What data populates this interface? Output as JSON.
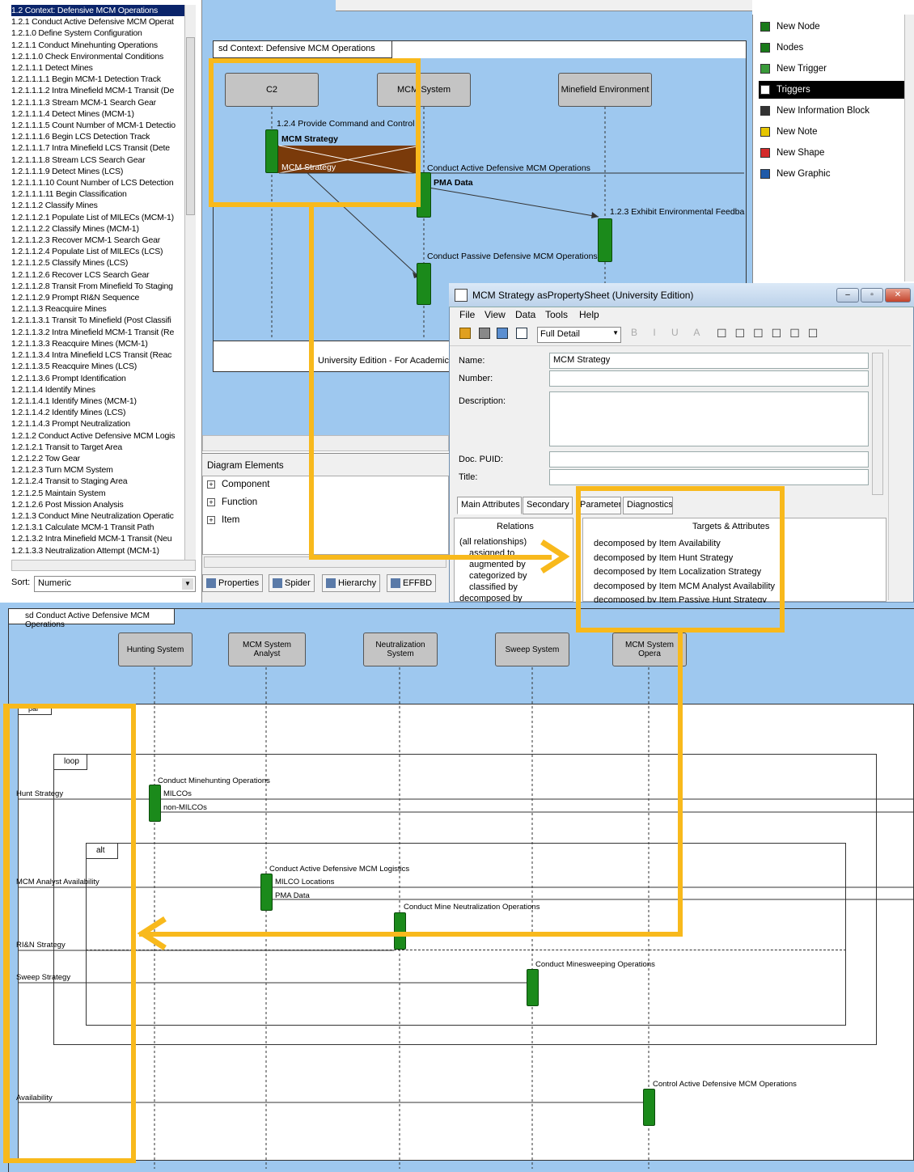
{
  "outline": {
    "items": [
      "1.2 Context: Defensive MCM Operations",
      "1.2.1 Conduct Active Defensive MCM Operat",
      "1.2.1.0 Define System Configuration",
      "1.2.1.1 Conduct Minehunting Operations",
      "1.2.1.1.0 Check Environmental Conditions",
      "1.2.1.1.1 Detect Mines",
      "1.2.1.1.1.1 Begin MCM-1 Detection Track",
      "1.2.1.1.1.2 Intra Minefield MCM-1 Transit (De",
      "1.2.1.1.1.3 Stream MCM-1 Search Gear",
      "1.2.1.1.1.4 Detect Mines (MCM-1)",
      "1.2.1.1.1.5 Count Number of MCM-1 Detectio",
      "1.2.1.1.1.6 Begin LCS Detection Track",
      "1.2.1.1.1.7 Intra Minefield LCS Transit (Dete",
      "1.2.1.1.1.8 Stream LCS Search Gear",
      "1.2.1.1.1.9 Detect Mines (LCS)",
      "1.2.1.1.1.10 Count Number of LCS Detection",
      "1.2.1.1.1.11 Begin Classification",
      "1.2.1.1.2 Classify Mines",
      "1.2.1.1.2.1 Populate List of MILECs (MCM-1)",
      "1.2.1.1.2.2 Classify Mines (MCM-1)",
      "1.2.1.1.2.3 Recover MCM-1 Search Gear",
      "1.2.1.1.2.4 Populate List of MILECs (LCS)",
      "1.2.1.1.2.5 Classify Mines (LCS)",
      "1.2.1.1.2.6 Recover LCS Search Gear",
      "1.2.1.1.2.8 Transit From Minefield To Staging",
      "1.2.1.1.2.9 Prompt RI&N Sequence",
      "1.2.1.1.3 Reacquire Mines",
      "1.2.1.1.3.1 Transit To Minefield (Post Classifi",
      "1.2.1.1.3.2 Intra Minefield MCM-1 Transit (Re",
      "1.2.1.1.3.3 Reacquire Mines (MCM-1)",
      "1.2.1.1.3.4 Intra Minefield LCS Transit (Reac",
      "1.2.1.1.3.5 Reacquire Mines (LCS)",
      "1.2.1.1.3.6 Prompt Identification",
      "1.2.1.1.4 Identify Mines",
      "1.2.1.1.4.1 Identify Mines (MCM-1)",
      "1.2.1.1.4.2 Identify Mines (LCS)",
      "1.2.1.1.4.3 Prompt Neutralization",
      "1.2.1.2 Conduct Active Defensive MCM Logis",
      "1.2.1.2.1 Transit to Target Area",
      "1.2.1.2.2 Tow Gear",
      "1.2.1.2.3 Turn MCM System",
      "1.2.1.2.4 Transit to Staging Area",
      "1.2.1.2.5 Maintain System",
      "1.2.1.2.6 Post Mission Analysis",
      "1.2.1.3 Conduct Mine Neutralization Operatic",
      "1.2.1.3.1 Calculate MCM-1 Transit Path",
      "1.2.1.3.2 Intra Minefield MCM-1 Transit (Neu",
      "1.2.1.3.3 Neutralization Attempt (MCM-1)"
    ],
    "sort_label": "Sort:",
    "sort_value": "Numeric"
  },
  "top_diagram": {
    "frame_title": "sd Context: Defensive MCM Operations",
    "lifelines": [
      "C2",
      "MCM System",
      "Minefield Environment"
    ],
    "msg_provide": "1.2.4 Provide Command and Control",
    "msg_strategy1": "MCM Strategy",
    "msg_strategy2": "MCM Strategy",
    "msg_active": "Conduct Active Defensive MCM Operations",
    "msg_pma": "PMA Data",
    "msg_env": "1.2.3 Exhibit Environmental Feedba",
    "msg_passive": "Conduct Passive Defensive MCM Operations",
    "footer": "University Edition - For Academic U"
  },
  "palette": {
    "items": [
      {
        "label": "New Node",
        "icon": "new-node-icon",
        "color": "#1a7a1a"
      },
      {
        "label": "Nodes",
        "icon": "nodes-icon",
        "color": "#1a7a1a"
      },
      {
        "label": "New Trigger",
        "icon": "new-trigger-icon",
        "color": "#3a9a3a"
      },
      {
        "label": "Triggers",
        "icon": "triggers-icon",
        "color": "#ffffff"
      },
      {
        "label": "New Information Block",
        "icon": "information-block-icon",
        "color": "#333333"
      },
      {
        "label": "New Note",
        "icon": "note-icon",
        "color": "#e6c600"
      },
      {
        "label": "New Shape",
        "icon": "shape-icon",
        "color": "#d42a2a"
      },
      {
        "label": "New Graphic",
        "icon": "graphic-icon",
        "color": "#1f5aa8"
      }
    ]
  },
  "diagram_elements": {
    "title": "Diagram Elements",
    "items": [
      "Component",
      "Function",
      "Item"
    ],
    "tabs": [
      "Properties",
      "Spider",
      "Hierarchy",
      "EFFBD"
    ]
  },
  "property_sheet": {
    "title": "MCM Strategy asPropertySheet (University Edition)",
    "menu": [
      "File",
      "View",
      "Data",
      "Tools",
      "Help"
    ],
    "detail": "Full Detail",
    "name_label": "Name:",
    "name_value": "MCM Strategy",
    "number_label": "Number:",
    "description_label": "Description:",
    "docpuid_label": "Doc. PUID:",
    "title_label": "Title:",
    "tabs": [
      "Main Attributes",
      "Secondary",
      "Parameters",
      "Diagnostics"
    ],
    "relations_header": "Relations",
    "relations": [
      "(all relationships)",
      "assigned to",
      "augmented by",
      "categorized by",
      "classified by",
      "decomposed by"
    ],
    "targets_header": "Targets & Attributes",
    "targets": [
      {
        "rel": "decomposed by Item",
        "target": "Availability"
      },
      {
        "rel": "decomposed by Item",
        "target": "Hunt Strategy"
      },
      {
        "rel": "decomposed by Item",
        "target": "Localization Strategy"
      },
      {
        "rel": "decomposed by Item",
        "target": "MCM Analyst Availability"
      },
      {
        "rel": "decomposed by Item",
        "target": "Passive Hunt Strategy"
      }
    ]
  },
  "bottom_diagram": {
    "frame_title": "sd Conduct Active Defensive MCM Operations",
    "lifelines": [
      "Hunting System",
      "MCM System Analyst",
      "Neutralization System",
      "Sweep System",
      "MCM System Opera"
    ],
    "par": "par",
    "loop": "loop",
    "alt": "alt",
    "left_labels": [
      "Hunt Strategy",
      "MCM Analyst Availability",
      "RI&N Strategy",
      "Sweep Strategy",
      "Availability"
    ],
    "msg_minehunting": "Conduct Minehunting Operations",
    "msg_milcos": "MILCOs",
    "msg_nonmilcos": "non-MILCOs",
    "msg_logistics": "Conduct Active Defensive MCM Logistics",
    "msg_milco_loc": "MILCO Locations",
    "msg_pma": "PMA Data",
    "msg_neutralization": "Conduct Mine Neutralization Operations",
    "msg_sweeping": "Conduct Minesweeping Operations",
    "msg_control": "Control Active Defensive MCM Operations"
  },
  "colors": {
    "highlight": "#f8b91c",
    "canvas": "#9ec8ef",
    "activation": "#1b8a1b"
  }
}
